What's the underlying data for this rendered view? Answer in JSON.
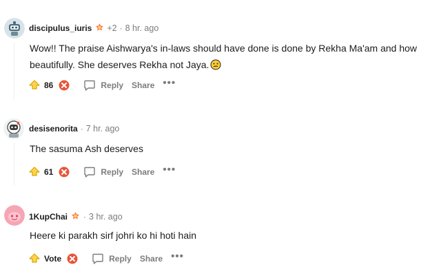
{
  "comments": [
    {
      "username": "discipulus_iuris",
      "award_extra": "+2",
      "time": "8 hr. ago",
      "text": "Wow!! The praise Aishwarya's in-laws should have done is done by Rekha Ma'am and how beautifully. She deserves Rekha not Jaya.",
      "score": "86",
      "avatar_icon": "robot-avatar-icon",
      "has_emoji": true
    },
    {
      "username": "desisenorita",
      "time": "7 hr. ago",
      "text": "The sasuma Ash deserves",
      "score": "61",
      "avatar_icon": "astronaut-avatar-icon",
      "has_emoji": false
    },
    {
      "username": "1KupChai",
      "time": "3 hr. ago",
      "text": "Heere ki parakh sirf johri ko hi hoti hain",
      "score": "Vote",
      "avatar_icon": "pink-snoo-avatar-icon",
      "has_emoji": false
    }
  ],
  "actions": {
    "reply": "Reply",
    "share": "Share",
    "more": "•••"
  },
  "colors": {
    "upvote": "#d9a400",
    "downvote": "#e8553a",
    "muted": "#7c7c7c"
  }
}
